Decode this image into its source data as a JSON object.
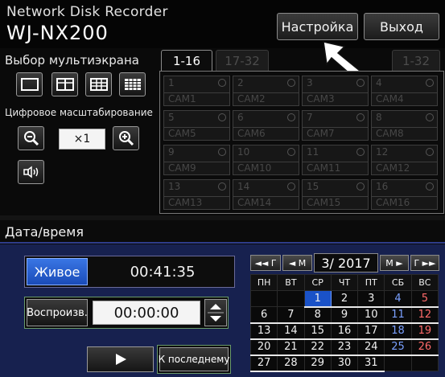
{
  "header": {
    "subtitle": "Network Disk Recorder",
    "title": "WJ-NX200",
    "settings_label": "Настройка",
    "exit_label": "Выход"
  },
  "multiscreen": {
    "label": "Выбор мультиэкрана",
    "layout_icons": [
      "single-screen-icon",
      "quad-screen-icon",
      "nine-screen-icon",
      "sixteen-screen-icon"
    ]
  },
  "zoom": {
    "label": "Цифровое масштабирование",
    "value": "×1",
    "zoom_out_icon": "zoom-out-icon",
    "zoom_in_icon": "zoom-in-icon",
    "audio_icon": "audio-icon"
  },
  "camera_tabs": {
    "active": "1-16",
    "next": "17-32",
    "right": "1-32"
  },
  "cameras": [
    {
      "num": "1",
      "name": "CAM1"
    },
    {
      "num": "2",
      "name": "CAM2"
    },
    {
      "num": "3",
      "name": "CAM3"
    },
    {
      "num": "4",
      "name": "CAM4"
    },
    {
      "num": "5",
      "name": "CAM5"
    },
    {
      "num": "6",
      "name": "CAM6"
    },
    {
      "num": "7",
      "name": "CAM7"
    },
    {
      "num": "8",
      "name": "CAM8"
    },
    {
      "num": "9",
      "name": "CAM9"
    },
    {
      "num": "10",
      "name": "CAM10"
    },
    {
      "num": "11",
      "name": "CAM11"
    },
    {
      "num": "12",
      "name": "CAM12"
    },
    {
      "num": "13",
      "name": "CAM13"
    },
    {
      "num": "14",
      "name": "CAM14"
    },
    {
      "num": "15",
      "name": "CAM15"
    },
    {
      "num": "16",
      "name": "CAM16"
    }
  ],
  "datetime": {
    "label": "Дата/время",
    "live_label": "Живое",
    "live_time": "00:41:35",
    "playback_label": "Воспроизв.",
    "playback_time": "00:00:00",
    "last_label": "К последнему",
    "play_icon": "play-icon"
  },
  "calendar": {
    "prev_year": "◄◄ Г",
    "prev_month": "◄ М",
    "month": "3/ 2017",
    "next_month": "М ►",
    "next_year": "Г ►►",
    "weekdays": [
      "ПН",
      "ВТ",
      "СР",
      "ЧТ",
      "ПТ",
      "СБ",
      "ВС"
    ],
    "weeks": [
      [
        "",
        "",
        "1",
        "2",
        "3",
        "4",
        "5"
      ],
      [
        "6",
        "7",
        "8",
        "9",
        "10",
        "11",
        "12"
      ],
      [
        "13",
        "14",
        "15",
        "16",
        "17",
        "18",
        "19"
      ],
      [
        "20",
        "21",
        "22",
        "23",
        "24",
        "25",
        "26"
      ],
      [
        "27",
        "28",
        "29",
        "30",
        "31",
        "",
        ""
      ]
    ],
    "selected_day": "1",
    "colors": {
      "saturday": "#7aa0ff",
      "sunday": "#ff6a6a",
      "selected": "#1a52c8",
      "live_button": "#2a63d4"
    }
  }
}
